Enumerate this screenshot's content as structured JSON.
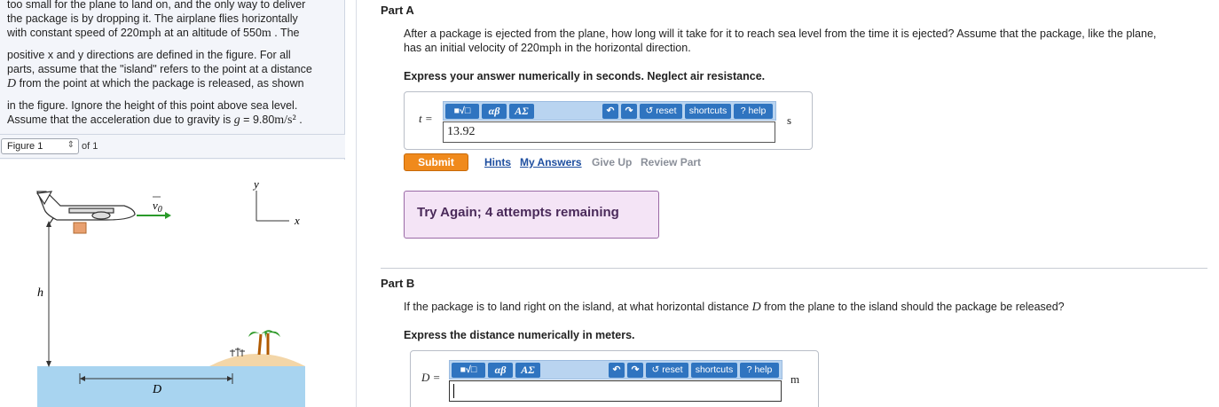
{
  "left": {
    "intro_line1": "too small for the plane to land on, and the only way to deliver",
    "intro_line2": "the package is by dropping it. The airplane flies horizontally",
    "intro_line3_a": "with constant speed of 220",
    "intro_line3_unit": "mph",
    "intro_line3_b": " at an altitude of 550",
    "intro_line3_unit2": "m",
    "intro_line3_c": " . The",
    "intro_line4": "positive x and y directions are defined in the figure. For all",
    "intro_line5": "parts, assume that the \"island\" refers to the point at a distance",
    "intro_line6_var": "D",
    "intro_line6": " from the point at which the package is released, as shown",
    "intro_line7": "in the figure. Ignore the height of this point above sea level.",
    "intro_line8_a": "Assume that the acceleration due to gravity is ",
    "intro_line8_var": "g",
    "intro_line8_b": " = 9.80",
    "intro_line8_unit": "m/s²",
    "intro_line8_c": " .",
    "figure_select": "Figure 1",
    "figure_of": "of 1",
    "figure_labels": {
      "v0": "v",
      "v0_sub": "0",
      "y": "y",
      "x": "x",
      "h": "h",
      "D": "D"
    }
  },
  "partA": {
    "title": "Part A",
    "question_line1": "After a package is ejected from the plane, how long will it take for it to reach sea level from the time it is ejected? Assume that the package, like the plane,",
    "question_line2_a": "has an initial velocity of 220",
    "question_line2_unit": "mph",
    "question_line2_b": " in the horizontal direction.",
    "instruction": "Express your answer numerically in seconds. Neglect air resistance.",
    "var_label": "t =",
    "unit": "s",
    "value": "13.92",
    "submit": "Submit",
    "hints": "Hints",
    "my_answers": "My Answers",
    "give_up": "Give Up",
    "review_part": "Review Part",
    "feedback": "Try Again; 4 attempts remaining"
  },
  "partB": {
    "title": "Part B",
    "question_a": "If the package is to land right on the island, at what horizontal distance ",
    "question_var": "D",
    "question_b": " from the plane to the island should the package be released?",
    "instruction": "Express the distance numerically in meters.",
    "var_label": "D =",
    "unit": "m",
    "value": ""
  },
  "toolbar": {
    "templates": "■√□",
    "greek": "αβ",
    "symbols": "ΑΣ",
    "reset": "reset",
    "shortcuts": "shortcuts",
    "help": "help",
    "help_q": "?"
  }
}
